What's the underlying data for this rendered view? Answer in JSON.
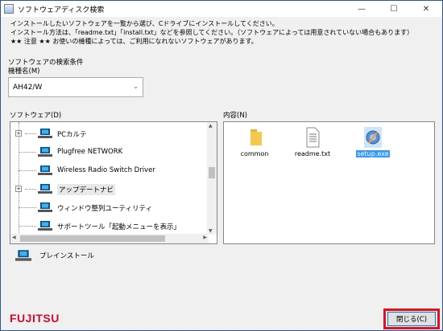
{
  "window": {
    "title": "ソフトウェアディスク検索",
    "controls": {
      "minimize": "—",
      "maximize": "☐",
      "close": "✕"
    }
  },
  "info_lines": [
    "インストールしたいソフトウェアを一覧から選び、Cドライブにインストールしてください。",
    "インストール方法は、「readme.txt」「install.txt」などを参照してください。（ソフトウェアによっては用意されていない場合もあります）",
    "★★ 注意 ★★ お使いの機種によっては、ご利用になれないソフトウェアがあります。"
  ],
  "search": {
    "conditions_label": "ソフトウェアの検索条件",
    "model_label": "機種名(M)",
    "model_value": "AH42/W"
  },
  "software": {
    "label": "ソフトウェア(D)",
    "items": [
      {
        "label": "PCカルテ",
        "expandable": true
      },
      {
        "label": "Plugfree NETWORK",
        "expandable": false
      },
      {
        "label": "Wireless Radio Switch Driver",
        "expandable": false
      },
      {
        "label": "アップデートナビ",
        "expandable": true
      },
      {
        "label": "ウィンドウ整列ユーティリティ",
        "expandable": false
      },
      {
        "label": "サポートツール「起動メニューを表示」",
        "expandable": false
      }
    ]
  },
  "contents": {
    "label": "内容(N)",
    "files": [
      {
        "name": "common",
        "icon": "folder-icon"
      },
      {
        "name": "readme.txt",
        "icon": "text-file-icon"
      },
      {
        "name": "setup.exe",
        "icon": "setup-icon",
        "selected": true
      }
    ]
  },
  "preinstall_label": "プレインストール",
  "brand": "FUJITSU",
  "close_button": "閉じる(C)",
  "colors": {
    "selection": "#3399ff",
    "brand_red": "#d30a2e",
    "highlight_outline": "#e0101c"
  }
}
